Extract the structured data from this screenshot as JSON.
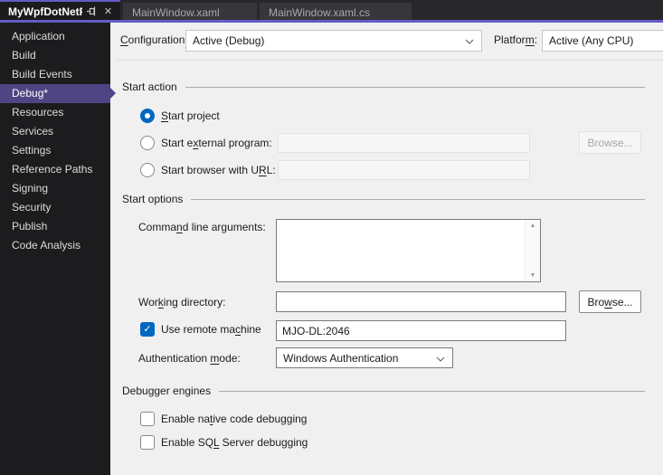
{
  "window": {
    "tabs": [
      {
        "label": "MyWpfDotNetF*",
        "state": "active"
      },
      {
        "label": "MainWindow.xaml",
        "state": "inactive"
      },
      {
        "label": "MainWindow.xaml.cs",
        "state": "inactive"
      }
    ],
    "close_glyph": "✕"
  },
  "sidebar": {
    "items": [
      {
        "label": "Application"
      },
      {
        "label": "Build"
      },
      {
        "label": "Build Events"
      },
      {
        "label": "Debug*",
        "selected": true
      },
      {
        "label": "Resources"
      },
      {
        "label": "Services"
      },
      {
        "label": "Settings"
      },
      {
        "label": "Reference Paths"
      },
      {
        "label": "Signing"
      },
      {
        "label": "Security"
      },
      {
        "label": "Publish"
      },
      {
        "label": "Code Analysis"
      }
    ]
  },
  "toolbar": {
    "configuration": {
      "pre": "",
      "key": "C",
      "post": "onfiguration:",
      "value": "Active (Debug)"
    },
    "platform": {
      "pre": "Platfor",
      "key": "m",
      "post": ":",
      "value": "Active (Any CPU)"
    }
  },
  "sections": {
    "start_action": {
      "title": "Start action",
      "start_project": {
        "pre": "",
        "key": "S",
        "post": "tart project",
        "checked": true
      },
      "external_program": {
        "pre": "Start e",
        "key": "x",
        "post": "ternal program:",
        "checked": false,
        "value": ""
      },
      "browse_disabled_label": "Browse...",
      "browser_url": {
        "pre": "Start browser with U",
        "key": "R",
        "post": "L:",
        "checked": false,
        "value": ""
      }
    },
    "start_options": {
      "title": "Start options",
      "command_line": {
        "pre": "Comma",
        "key": "n",
        "post": "d line arguments:",
        "value": ""
      },
      "working_directory": {
        "pre": "Wor",
        "key": "k",
        "post": "ing directory:",
        "value": ""
      },
      "browse": {
        "pre": "Bro",
        "key": "w",
        "post": "se..."
      },
      "use_remote_machine": {
        "pre": "Use remote ma",
        "key": "c",
        "post": "hine",
        "checked": true,
        "value": "MJO-DL:2046"
      },
      "authentication_mode": {
        "pre": "Authentication ",
        "key": "m",
        "post": "ode:",
        "value": "Windows Authentication"
      }
    },
    "debugger_engines": {
      "title": "Debugger engines",
      "native_debugging": {
        "pre": "Enable na",
        "key": "t",
        "post": "ive code debugging",
        "checked": false
      },
      "sql_debugging": {
        "pre": "Enable SQ",
        "key": "L",
        "post": " Server debugging",
        "checked": false
      }
    }
  },
  "scrollbar": {
    "up_glyph": "▲",
    "down_glyph": "▼"
  },
  "colors": {
    "accent_purple": "#635cc9",
    "sidebar_selection_purple": "#4f4584",
    "control_blue": "#0067c0",
    "panel_background": "#f0f0f0",
    "dark_background": "#1c1c1e"
  }
}
